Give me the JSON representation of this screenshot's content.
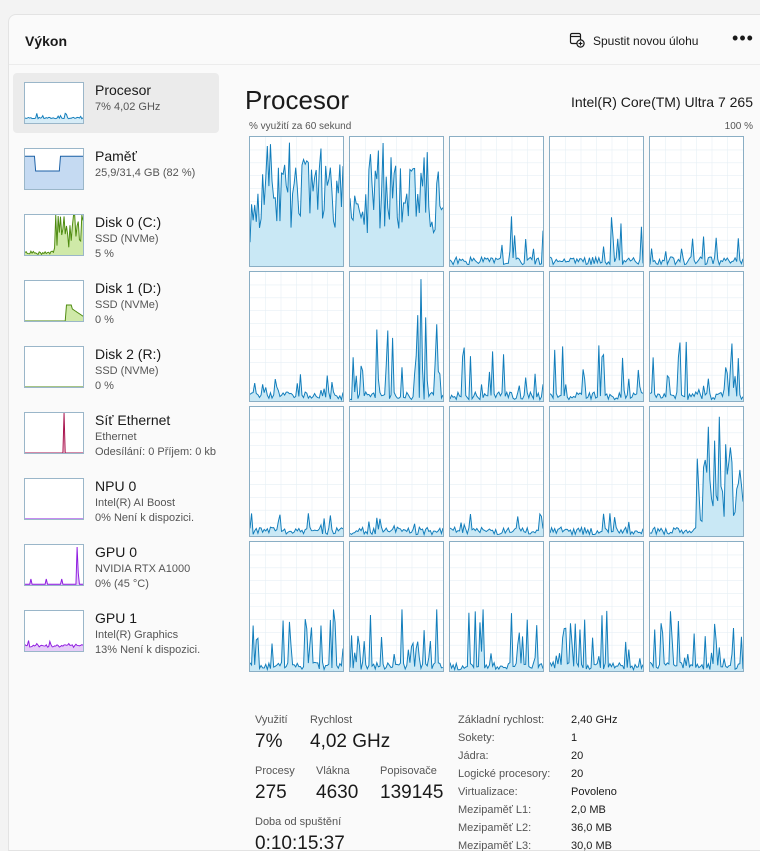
{
  "header": {
    "title": "Výkon",
    "run_task_label": "Spustit novou úlohu",
    "more_label": "•••"
  },
  "sidebar": {
    "items": [
      {
        "name": "Procesor",
        "sub1": "7% 4,02 GHz",
        "sub2": "",
        "graph": "cpu",
        "color": "#117dbb",
        "fill": "#d6ecf7"
      },
      {
        "name": "Paměť",
        "sub1": "25,9/31,4 GB (82 %)",
        "sub2": "",
        "graph": "memory",
        "color": "#1a5fa5",
        "fill": "#c5daf2"
      },
      {
        "name": "Disk 0 (C:)",
        "sub1": "SSD (NVMe)",
        "sub2": "5 %",
        "graph": "disk0",
        "color": "#4d8a0e",
        "fill": "#cfe9a8"
      },
      {
        "name": "Disk 1 (D:)",
        "sub1": "SSD (NVMe)",
        "sub2": "0 %",
        "graph": "disk1",
        "color": "#4d8a0e",
        "fill": "#cfe9a8"
      },
      {
        "name": "Disk 2 (R:)",
        "sub1": "SSD (NVMe)",
        "sub2": "0 %",
        "graph": "disk2",
        "color": "#4d8a0e",
        "fill": "#cfe9a8"
      },
      {
        "name": "Síť Ethernet",
        "sub1": "Ethernet",
        "sub2": "Odesílání: 0 Příjem: 0 kb",
        "graph": "net",
        "color": "#a7114c",
        "fill": "#f2c8d8"
      },
      {
        "name": "NPU 0",
        "sub1": "Intel(R) AI Boost",
        "sub2": "0% Není k dispozici.",
        "graph": "npu",
        "color": "#8e1ae0",
        "fill": "#e6ccf8"
      },
      {
        "name": "GPU 0",
        "sub1": "NVIDIA RTX A1000",
        "sub2": "0% (45 °C)",
        "graph": "gpu0",
        "color": "#8e1ae0",
        "fill": "#e6ccf8"
      },
      {
        "name": "GPU 1",
        "sub1": "Intel(R) Graphics",
        "sub2": "13% Není k dispozici.",
        "graph": "gpu1",
        "color": "#8e1ae0",
        "fill": "#e6ccf8"
      }
    ]
  },
  "main": {
    "title": "Procesor",
    "cpu_model": "Intel(R) Core(TM) Ultra 7 265",
    "graph_label": "% využití za 60 sekund",
    "graph_max": "100 %",
    "core_line_color": "#117dbb",
    "core_fill_color": "#c9e8f5",
    "core_grid_color": "#e6eff5",
    "stats": {
      "utilization_label": "Využití",
      "utilization_value": "7%",
      "speed_label": "Rychlost",
      "speed_value": "4,02 GHz",
      "processes_label": "Procesy",
      "processes_value": "275",
      "threads_label": "Vlákna",
      "threads_value": "4630",
      "handles_label": "Popisovače",
      "handles_value": "139145",
      "uptime_label": "Doba od spuštění",
      "uptime_value": "0:10:15:37"
    },
    "specs": [
      {
        "label": "Základní rychlost:",
        "value": "2,40 GHz"
      },
      {
        "label": "Sokety:",
        "value": "1"
      },
      {
        "label": "Jádra:",
        "value": "20"
      },
      {
        "label": "Logické procesory:",
        "value": "20"
      },
      {
        "label": "Virtualizace:",
        "value": "Povoleno"
      },
      {
        "label": "Mezipaměť L1:",
        "value": "2,0 MB"
      },
      {
        "label": "Mezipaměť L2:",
        "value": "36,0 MB"
      },
      {
        "label": "Mezipaměť L3:",
        "value": "30,0 MB"
      }
    ],
    "cores": [
      {
        "profile": "heavy",
        "seed": 11
      },
      {
        "profile": "heavy",
        "seed": 23
      },
      {
        "profile": "late-spike",
        "seed": 31
      },
      {
        "profile": "late-spike",
        "seed": 47
      },
      {
        "profile": "light",
        "seed": 53
      },
      {
        "profile": "light",
        "seed": 61
      },
      {
        "profile": "tall-spike",
        "seed": 71
      },
      {
        "profile": "medium",
        "seed": 83
      },
      {
        "profile": "medium",
        "seed": 97
      },
      {
        "profile": "medium",
        "seed": 103
      },
      {
        "profile": "idle",
        "seed": 109
      },
      {
        "profile": "idle",
        "seed": 113
      },
      {
        "profile": "idle",
        "seed": 127
      },
      {
        "profile": "idle",
        "seed": 131
      },
      {
        "profile": "late-heavy",
        "seed": 137
      },
      {
        "profile": "medium",
        "seed": 139
      },
      {
        "profile": "medium",
        "seed": 149
      },
      {
        "profile": "medium",
        "seed": 151
      },
      {
        "profile": "medium",
        "seed": 157
      },
      {
        "profile": "medium",
        "seed": 163
      }
    ]
  }
}
